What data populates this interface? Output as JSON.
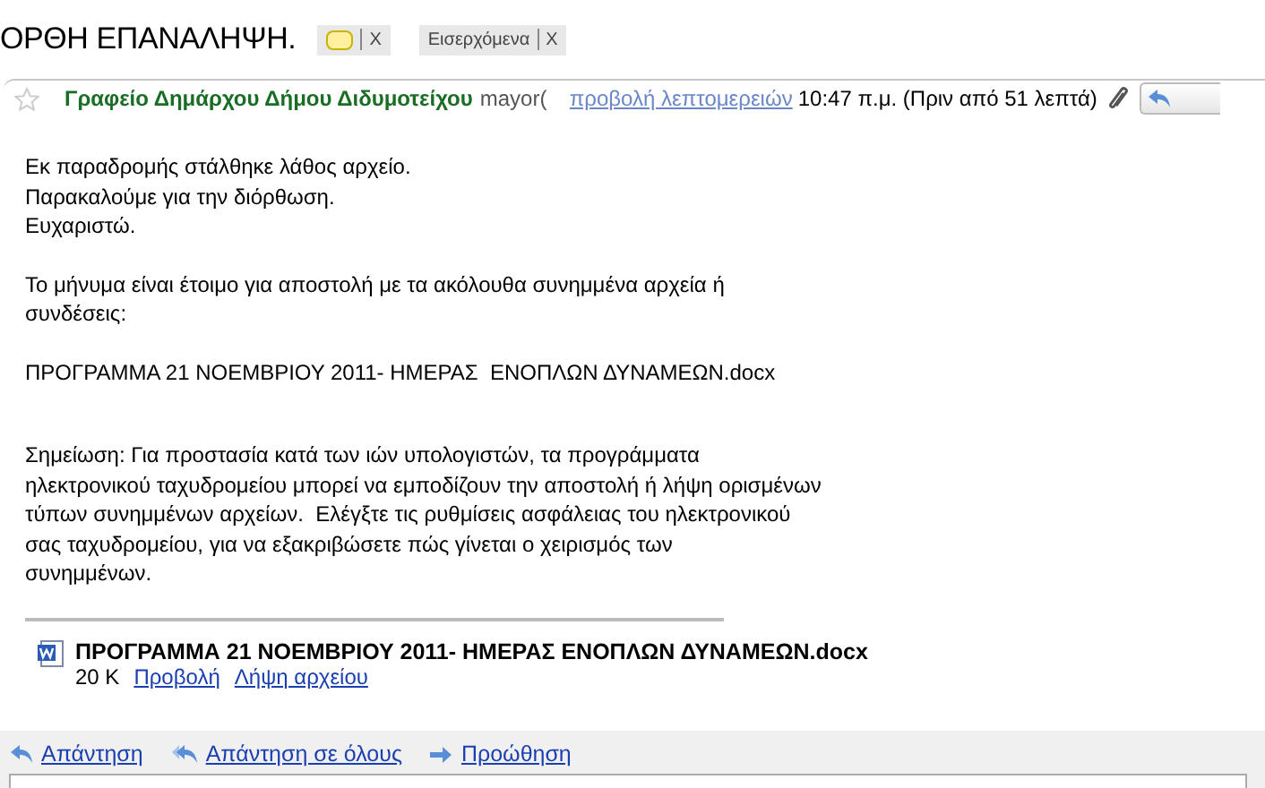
{
  "subject": "ΟΡΘΗ ΕΠΑΝΑΛΗΨΗ.",
  "labels": [
    {
      "kind": "color",
      "color": "#fff0a0",
      "remove": "X"
    },
    {
      "kind": "text",
      "text": "Εισερχόμενα",
      "remove": "X"
    }
  ],
  "header": {
    "starred": false,
    "sender": "Γραφείο Δημάρχου Δήμου Διδυμοτείχου",
    "address": "mayor(",
    "details_link": "προβολή λεπτομερειών",
    "time": "10:47 π.μ. (Πριν από 51 λεπτά)"
  },
  "body": [
    "Εκ παραδρομής στάλθηκε λάθος αρχείο.\nΠαρακαλούμε για την διόρθωση.\nΕυχαριστώ.",
    "Το μήνυμα είναι έτοιμο για αποστολή με τα ακόλουθα συνημμένα αρχεία ή\nσυνδέσεις:",
    "ΠΡΟΓΡΑΜΜΑ 21 ΝΟΕΜΒΡΙΟΥ 2011- ΗΜΕΡΑΣ  ΕΝΟΠΛΩΝ ΔΥΝΑΜΕΩΝ.docx",
    "Σημείωση: Για προστασία κατά των ιών υπολογιστών, τα προγράμματα\nηλεκτρονικού ταχυδρομείου μπορεί να εμποδίζουν την αποστολή ή λήψη ορισμένων\nτύπων συνημμένων αρχείων.  Ελέγξτε τις ρυθμίσεις ασφάλειας του ηλεκτρονικού\nσας ταχυδρομείου, για να εξακριβώσετε πώς γίνεται ο χειρισμός των\nσυνημμένων."
  ],
  "attachment": {
    "name": "ΠΡΟΓΡΑΜΜΑ 21 ΝΟΕΜΒΡΙΟΥ 2011- ΗΜΕΡΑΣ ΕΝΟΠΛΩΝ ΔΥΝΑΜΕΩΝ.docx",
    "size": "20 K",
    "links": [
      "Προβολή",
      "Λήψη αρχείου"
    ]
  },
  "actions": [
    {
      "kind": "reply",
      "label": "Απάντηση"
    },
    {
      "kind": "reply_all",
      "label": "Απάντηση σε όλους"
    },
    {
      "kind": "forward",
      "label": "Προώθηση"
    }
  ]
}
